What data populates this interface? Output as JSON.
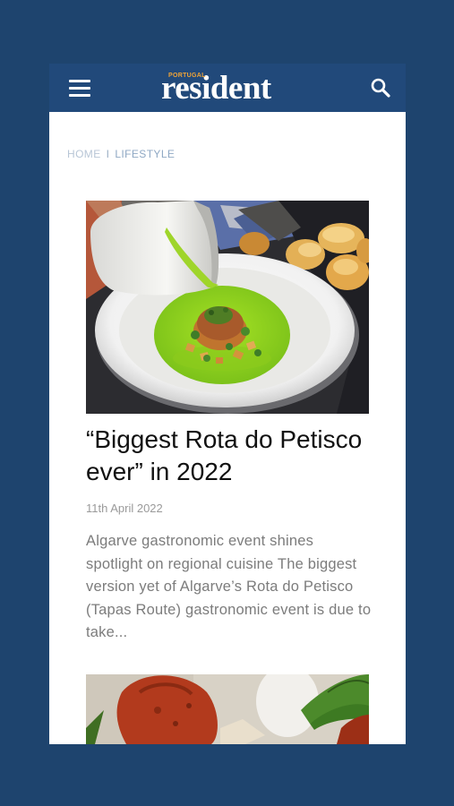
{
  "header": {
    "logo_small": "PORTUGAL",
    "logo_main": "resident",
    "menu_icon": "hamburger-menu-icon",
    "search_icon": "search-icon",
    "bar_color": "#21497a",
    "logo_accent_color": "#f0a437"
  },
  "breadcrumb": {
    "home": "HOME",
    "separator": "I",
    "current": "LIFESTYLE"
  },
  "article": {
    "title": "“Biggest Rota do Petisco ever” in 2022",
    "date": "11th April 2022",
    "excerpt": "Algarve gastronomic event shines spotlight on regional cuisine The biggest version yet of Algarve’s Rota do Petisco (Tapas Route) gastronomic event is due to take..."
  },
  "colors": {
    "page_background": "#1e446e",
    "card_background": "#ffffff"
  }
}
